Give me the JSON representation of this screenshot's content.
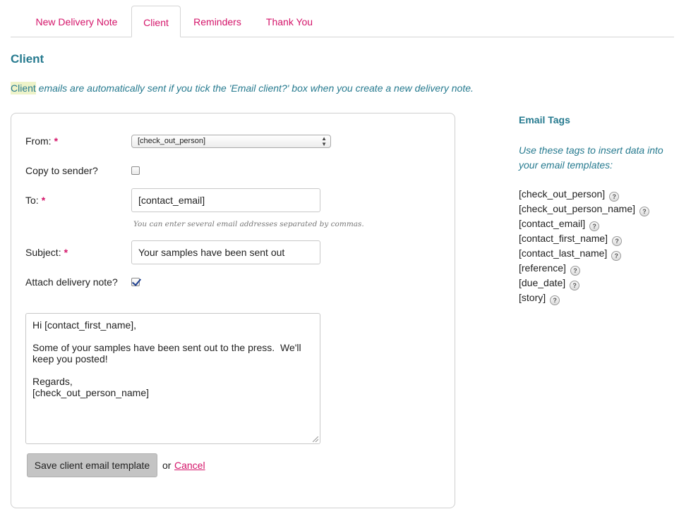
{
  "tabs": [
    {
      "label": "New Delivery Note",
      "active": false
    },
    {
      "label": "Client",
      "active": true
    },
    {
      "label": "Reminders",
      "active": false
    },
    {
      "label": "Thank You",
      "active": false
    }
  ],
  "page": {
    "title": "Client",
    "intro_highlight": "Client",
    "intro_rest": " emails are automatically sent if you tick the 'Email client?' box when you create a new delivery note."
  },
  "form": {
    "from_label": "From:",
    "from_value": "[check_out_person]",
    "copy_label": "Copy to sender?",
    "copy_checked": false,
    "to_label": "To:",
    "to_value": "[contact_email]",
    "to_hint": "You can enter several email addresses separated by commas.",
    "subject_label": "Subject:",
    "subject_value": "Your samples have been sent out",
    "attach_label": "Attach delivery note?",
    "attach_checked": true,
    "body": "Hi [contact_first_name],\n\nSome of your samples have been sent out to the press.  We'll keep you posted!\n\nRegards,\n[check_out_person_name]",
    "required_marker": "*",
    "save_label": "Save client email template",
    "or_text": "or",
    "cancel_label": "Cancel"
  },
  "sidebar": {
    "title": "Email Tags",
    "description": "Use these tags to insert data into your email templates:",
    "help_glyph": "?",
    "tags": [
      "[check_out_person]",
      "[check_out_person_name]",
      "[contact_email]",
      "[contact_first_name]",
      "[contact_last_name]",
      "[reference]",
      "[due_date]",
      "[story]"
    ]
  },
  "colors": {
    "accent_pink": "#d4156a",
    "accent_teal": "#267a8f",
    "highlight": "#eef3c9"
  }
}
